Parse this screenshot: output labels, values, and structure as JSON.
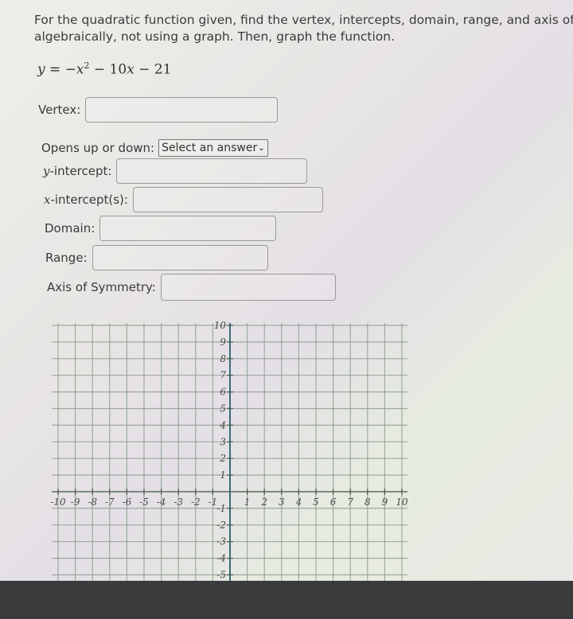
{
  "question": {
    "prompt_line1": "For the quadratic function given, find the vertex, intercepts, domain, range, and axis of",
    "prompt_line2": "algebraically, not using a graph. Then, graph the function.",
    "equation": {
      "lhs": "y",
      "eq": " = −",
      "var": "x",
      "exp": "2",
      "rest1": " − 10",
      "var2": "x",
      "rest2": " − 21"
    }
  },
  "fields": {
    "vertex": {
      "label": "Vertex:",
      "value": ""
    },
    "opens": {
      "label": "Opens up or down:",
      "selected": "Select an answer"
    },
    "y_intercept": {
      "label_var": "y",
      "label_rest": "-intercept:",
      "value": ""
    },
    "x_intercepts": {
      "label_var": "x",
      "label_rest": "-intercept(s):",
      "value": ""
    },
    "domain": {
      "label": "Domain:",
      "value": ""
    },
    "range": {
      "label": "Range:",
      "value": ""
    },
    "axis": {
      "label": "Axis of Symmetry:",
      "value": ""
    }
  },
  "chart_data": {
    "type": "line",
    "title": "",
    "xlabel": "",
    "ylabel": "",
    "xlim": [
      -10,
      10
    ],
    "ylim": [
      -5,
      10
    ],
    "grid": true,
    "x_ticks": [
      -10,
      -9,
      -8,
      -7,
      -6,
      -5,
      -4,
      -3,
      -2,
      -1,
      1,
      2,
      3,
      4,
      5,
      6,
      7,
      8,
      9,
      10
    ],
    "y_ticks": [
      10,
      9,
      8,
      7,
      6,
      5,
      4,
      3,
      2,
      1,
      -1,
      -2,
      -3,
      -4,
      -5
    ],
    "series": []
  }
}
